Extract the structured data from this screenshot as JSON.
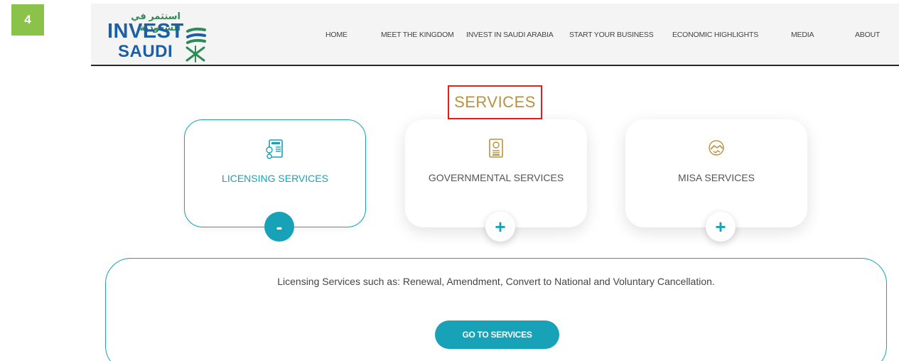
{
  "step_badge": "4",
  "brand": {
    "arabic": "استثمر في السعودية",
    "line1": "INVEST",
    "line2": "SAUDI"
  },
  "nav": [
    {
      "label": "HOME"
    },
    {
      "label": "MEET THE KINGDOM"
    },
    {
      "label": "INVEST IN SAUDI ARABIA"
    },
    {
      "label": "START YOUR BUSINESS"
    },
    {
      "label": "ECONOMIC HIGHLIGHTS"
    },
    {
      "label": "MEDIA"
    },
    {
      "label": "ABOUT"
    }
  ],
  "services": {
    "title": "SERVICES",
    "cards": [
      {
        "label": "LICENSING SERVICES",
        "icon": "license-document-icon",
        "toggle": "-",
        "active": true
      },
      {
        "label": "GOVERNMENTAL SERVICES",
        "icon": "government-document-icon",
        "toggle": "+",
        "active": false
      },
      {
        "label": "MISA SERVICES",
        "icon": "handshake-icon",
        "toggle": "+",
        "active": false
      }
    ]
  },
  "detail": {
    "text": "Licensing Services such as: Renewal, Amendment, Convert to National and Voluntary Cancellation.",
    "button": "GO TO SERVICES"
  },
  "colors": {
    "teal": "#17a2b8",
    "gold": "#b8923f",
    "brand_blue": "#1b5fa6",
    "brand_green": "#2e8b57",
    "highlight_red": "#e0201e",
    "badge_green": "#8bc34a"
  }
}
